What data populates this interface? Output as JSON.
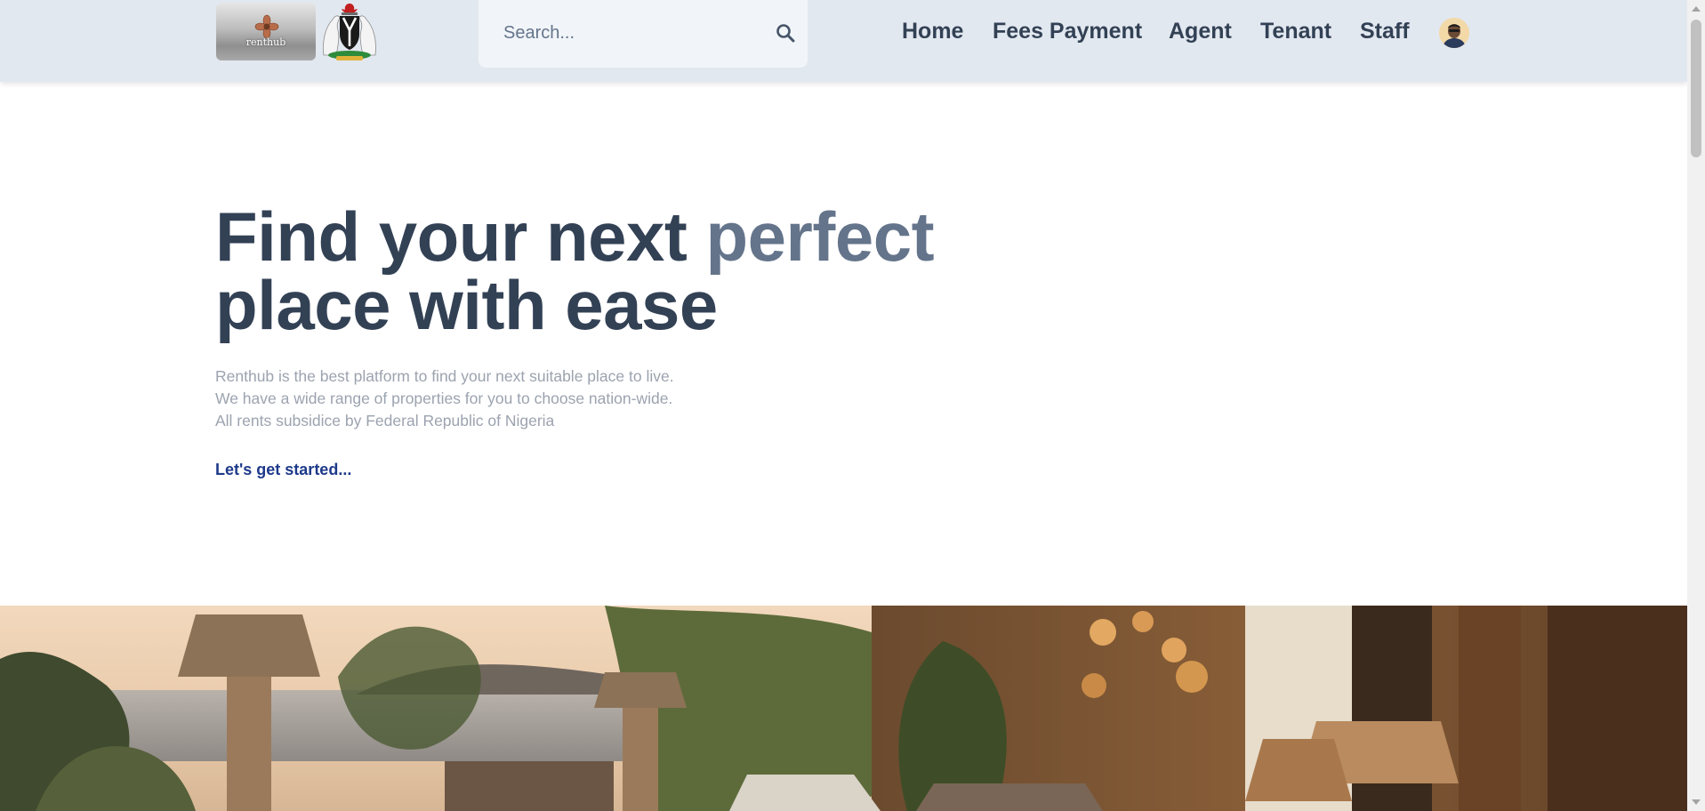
{
  "header": {
    "logo_text": "renthub",
    "search": {
      "placeholder": "Search..."
    },
    "nav": [
      {
        "label": "Home"
      },
      {
        "label": "Fees Payment"
      },
      {
        "label": "Agent"
      },
      {
        "label": "Tenant"
      },
      {
        "label": "Staff"
      }
    ]
  },
  "hero": {
    "title_part1": "Find your next ",
    "title_accent": "perfect",
    "title_part2": "place with ease",
    "subtitle_lines": [
      "Renthub is the best platform to find your next suitable place to live.",
      "We have a wide range of properties for you to choose nation-wide.",
      "All rents subsidice by Federal Republic of Nigeria"
    ],
    "cta_label": "Let's get started..."
  },
  "colors": {
    "header_bg": "#e2e8f0",
    "nav_text": "#334155",
    "title_text": "#334155",
    "title_accent": "#64748b",
    "subtitle_text": "#9ca3af",
    "cta_text": "#1e3a8a"
  },
  "icons": {
    "search": "search-icon",
    "avatar": "user-avatar",
    "logo": "renthub-logo",
    "coat_of_arms": "nigeria-coat-of-arms-icon"
  }
}
